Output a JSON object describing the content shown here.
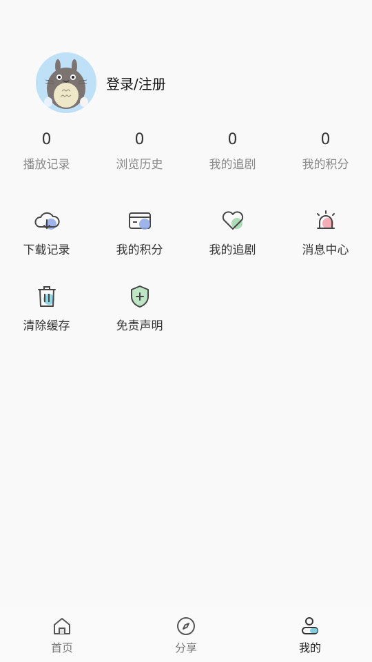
{
  "profile": {
    "login_text": "登录/注册"
  },
  "stats": [
    {
      "value": "0",
      "label": "播放记录"
    },
    {
      "value": "0",
      "label": "浏览历史"
    },
    {
      "value": "0",
      "label": "我的追剧"
    },
    {
      "value": "0",
      "label": "我的积分"
    }
  ],
  "menu": [
    {
      "label": "下载记录",
      "icon": "cloud-download-icon"
    },
    {
      "label": "我的积分",
      "icon": "card-icon"
    },
    {
      "label": "我的追剧",
      "icon": "heart-icon"
    },
    {
      "label": "消息中心",
      "icon": "alarm-icon"
    },
    {
      "label": "清除缓存",
      "icon": "trash-icon"
    },
    {
      "label": "免责声明",
      "icon": "shield-icon"
    }
  ],
  "tabs": [
    {
      "label": "首页",
      "icon": "home-icon"
    },
    {
      "label": "分享",
      "icon": "compass-icon"
    },
    {
      "label": "我的",
      "icon": "user-icon",
      "active": true
    }
  ],
  "colors": {
    "accent_blue": "#8fa8e8",
    "accent_green": "#9fd6a8",
    "accent_pink": "#f3a3ad",
    "accent_cyan": "#7fd0e0"
  }
}
